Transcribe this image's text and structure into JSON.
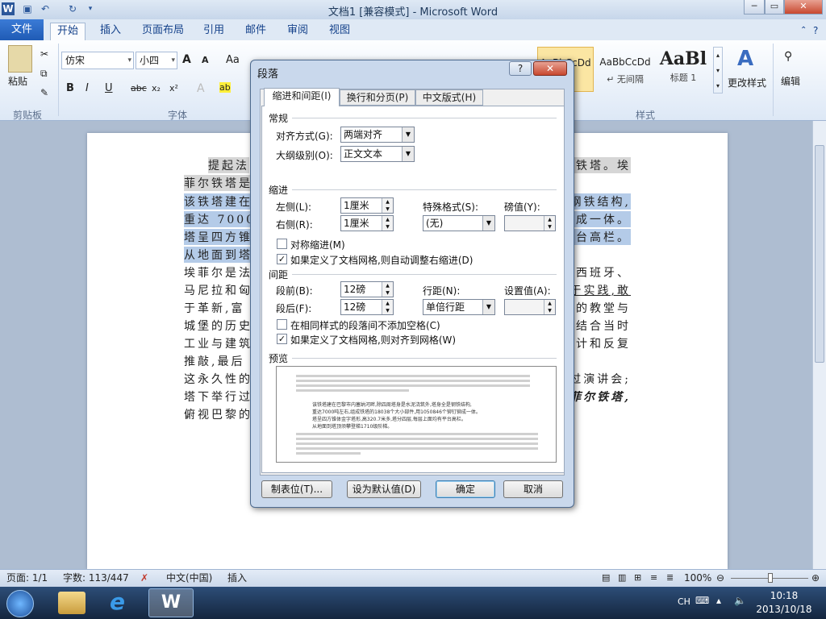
{
  "window": {
    "title": "文档1 [兼容模式] - Microsoft Word",
    "app_icon": "W",
    "min": "─",
    "max": "▭",
    "close": "✕"
  },
  "ribbon_tabs": [
    "文件",
    "开始",
    "插入",
    "页面布局",
    "引用",
    "邮件",
    "审阅",
    "视图"
  ],
  "ribbon": {
    "paste": "粘贴",
    "clipboard_group": "剪贴板",
    "font_name": "仿宋",
    "font_size": "小四",
    "font_group": "字体",
    "grow": "A",
    "shrink": "A",
    "case": "Aa",
    "bold": "B",
    "italic": "I",
    "underline": "U",
    "strike": "abc",
    "sub": "x₂",
    "sup": "x²",
    "styles": [
      {
        "preview": "AaBbCcDd",
        "name": "文"
      },
      {
        "preview": "AaBbCcDd",
        "name": "↵ 无间隔"
      },
      {
        "preview": "AaBl",
        "name": "标题 1"
      }
    ],
    "styles_group": "样式",
    "change_styles": "更改样式",
    "edit": "编辑"
  },
  "document": {
    "lines": [
      {
        "left": "提起法",
        "right": "尔铁塔。埃"
      },
      {
        "left": "菲尔铁塔是",
        "right": ""
      },
      {
        "left": "该铁塔建在",
        "right": "钢铁结构,"
      },
      {
        "left": "重达 7000 吨",
        "right": "铆成一体。"
      },
      {
        "left": "塔呈四方锥",
        "right": "平台高栏。"
      },
      {
        "left": "从地面到塔",
        "right": ""
      },
      {
        "left": "埃菲尔是法",
        "right": "在西班牙、"
      },
      {
        "left": "马尼拉和匈",
        "right": "于实践,敢"
      },
      {
        "left": "于革新,富",
        "right": "的教堂与"
      },
      {
        "left": "城堡的历史",
        "right": "结合当时"
      },
      {
        "left": "工业与建筑",
        "right": "计和反复"
      },
      {
        "left": "推敲,最后",
        "right": ""
      },
      {
        "left": "这永久性的",
        "right": "过演讲会;"
      },
      {
        "left": "塔下举行过",
        "right": "菲尔铁塔,"
      },
      {
        "left": "俯视巴黎的",
        "right": ""
      }
    ],
    "para_mark": "↵"
  },
  "dialog": {
    "title": "段落",
    "help": "?",
    "close": "✕",
    "tabs": [
      "缩进和间距(I)",
      "换行和分页(P)",
      "中文版式(H)"
    ],
    "general_section": "常规",
    "alignment_label": "对齐方式(G):",
    "alignment_value": "两端对齐",
    "outline_label": "大纲级别(O):",
    "outline_value": "正文文本",
    "indent_section": "缩进",
    "left_label": "左侧(L):",
    "left_value": "1厘米",
    "right_label": "右侧(R):",
    "right_value": "1厘米",
    "special_label": "特殊格式(S):",
    "special_value": "(无)",
    "by_label": "磅值(Y):",
    "by_value": "",
    "mirror_label": "对称缩进(M)",
    "mirror_checked": false,
    "auto_indent_label": "如果定义了文档网格,则自动调整右缩进(D)",
    "auto_indent_checked": true,
    "spacing_section": "间距",
    "before_label": "段前(B):",
    "before_value": "12磅",
    "after_label": "段后(F):",
    "after_value": "12磅",
    "line_label": "行距(N):",
    "line_value": "单倍行距",
    "at_label": "设置值(A):",
    "at_value": "",
    "no_space_label": "在相同样式的段落间不添加空格(C)",
    "no_space_checked": false,
    "snap_label": "如果定义了文档网格,则对齐到网格(W)",
    "snap_checked": true,
    "preview_section": "预览",
    "preview_lines": [
      "该铁塔建在巴黎市内塞纳河畔,除四周塔身是水泥浇筑外,塔身全是钢铁结构,",
      "重达7000吨左右,组成铁塔的18038个大小部件,用1050846个铆钉铆成一体。",
      "塔呈四方锥体金字塔形,高320.7米多,塔分四层,每层上面均有平台高栏。",
      "从地面到塔顶须攀登梯1710级阶梯。"
    ],
    "btn_tabs": "制表位(T)...",
    "btn_default": "设为默认值(D)",
    "btn_ok": "确定",
    "btn_cancel": "取消"
  },
  "status": {
    "page": "页面: 1/1",
    "words": "字数: 113/447",
    "language": "中文(中国)",
    "insert": "插入",
    "zoom": "100%"
  },
  "taskbar": {
    "ime": "CH",
    "time": "10:18",
    "date": "2013/10/18"
  }
}
